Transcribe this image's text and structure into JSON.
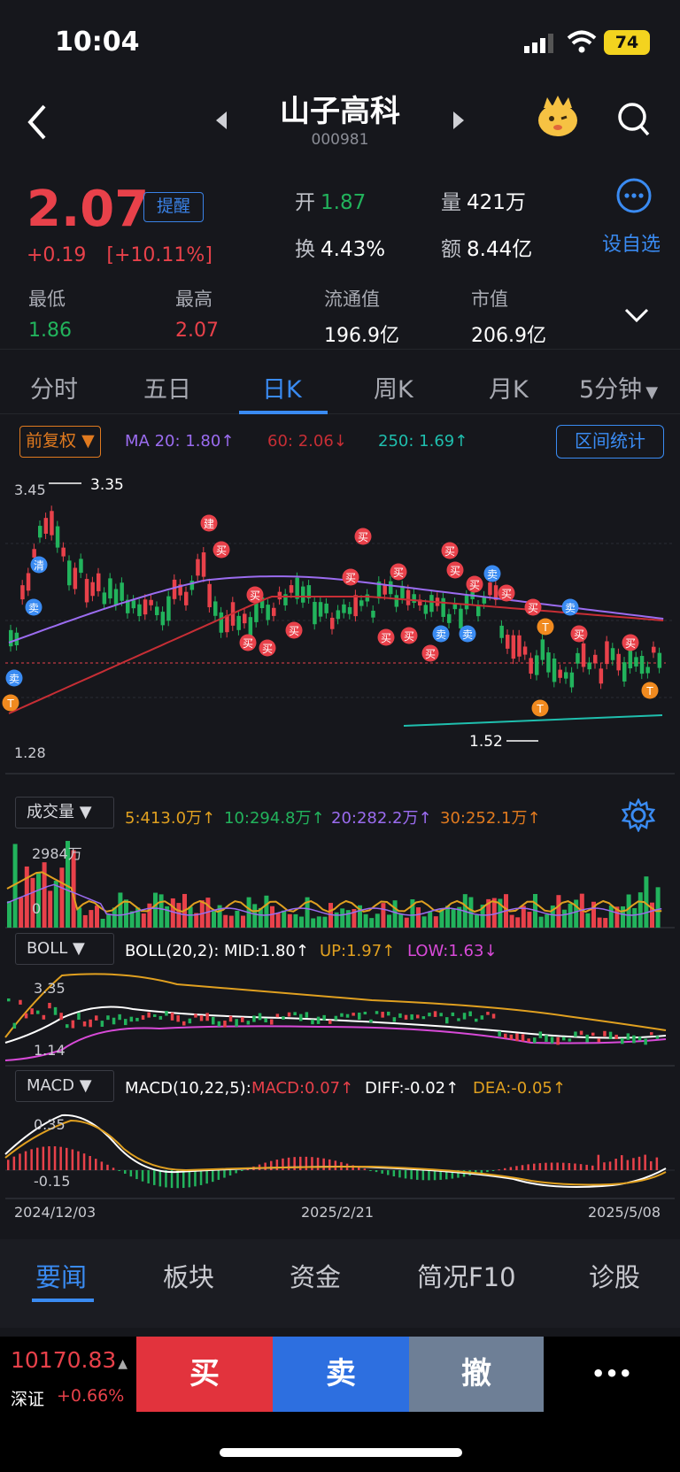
{
  "status": {
    "time": "10:04",
    "battery": "74"
  },
  "header": {
    "title": "山子高科",
    "code": "000981"
  },
  "quote": {
    "price": "2.07",
    "change": "+0.19",
    "change_pct": "[+10.11%]",
    "remind": "提醒",
    "open_label": "开",
    "open": "1.87",
    "volume_label": "量",
    "volume": "421万",
    "turnover_label": "换",
    "turnover": "4.43%",
    "amount_label": "额",
    "amount": "8.44亿",
    "add_watch": "设自选",
    "low_label": "最低",
    "low": "1.86",
    "high_label": "最高",
    "high": "2.07",
    "float_label": "流通值",
    "float_value": "196.9亿",
    "mcap_label": "市值",
    "mcap": "206.9亿"
  },
  "tabs": [
    {
      "label": "分时"
    },
    {
      "label": "五日"
    },
    {
      "label": "日K"
    },
    {
      "label": "周K"
    },
    {
      "label": "月K"
    },
    {
      "label": "5分钟"
    }
  ],
  "kline": {
    "adjust": "前复权",
    "ma20": "MA 20: 1.80↑",
    "ma60": "60: 2.06↓",
    "ma250": "250: 1.69↑",
    "range_btn": "区间统计",
    "y_top": "3.45",
    "y_bottom": "1.28",
    "max_label": "3.35",
    "min_label": "1.52"
  },
  "volume": {
    "label": "成交量",
    "ma5": "5:413.0万↑",
    "ma10": "10:294.8万↑",
    "ma20": "20:282.2万↑",
    "ma30": "30:252.1万↑",
    "y_top": "2984万",
    "y_bottom": "0"
  },
  "boll": {
    "label": "BOLL",
    "title": "BOLL(20,2):",
    "mid": "MID:1.80↑",
    "up": "UP:1.97↑",
    "low": "LOW:1.63↓",
    "y_top": "3.35",
    "y_bottom": "1.14"
  },
  "macd": {
    "label": "MACD",
    "title": "MACD(10,22,5):",
    "macd": "MACD:0.07↑",
    "diff": "DIFF:-0.02↑",
    "dea": "DEA:-0.05↑",
    "y_top": "0.35",
    "y_bottom": "-0.15"
  },
  "dates": {
    "start": "2024/12/03",
    "mid": "2025/2/21",
    "end": "2025/5/08"
  },
  "bottom_tabs": [
    {
      "label": "要闻"
    },
    {
      "label": "板块"
    },
    {
      "label": "资金"
    },
    {
      "label": "简况F10"
    },
    {
      "label": "诊股"
    }
  ],
  "footer": {
    "index_value": "10170.83",
    "index_name": "深证",
    "index_chg": "+0.66%",
    "buy": "买",
    "sell": "卖",
    "cancel": "撤",
    "more": "•••"
  },
  "colors": {
    "up": "#e8414a",
    "down": "#22b35c",
    "accent": "#3a8bf2",
    "ma20": "#9b6cf0",
    "ma60": "#c72e35",
    "ma250": "#1fbfae"
  }
}
